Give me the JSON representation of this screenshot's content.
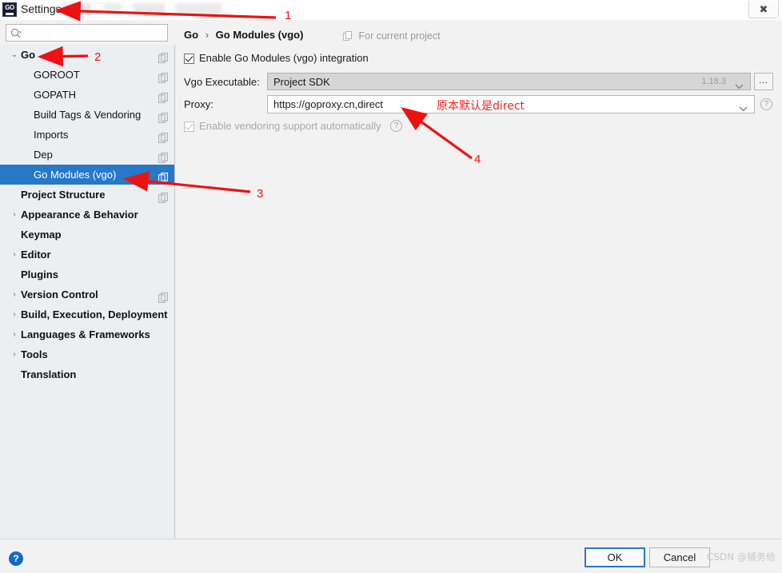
{
  "window": {
    "title": "Settings",
    "app_icon": "goland-logo-icon",
    "close_label": "✖",
    "blurred_subtitle": ""
  },
  "search": {
    "value": "",
    "placeholder": "",
    "icon": "search-icon"
  },
  "sidebar": {
    "items": [
      {
        "label": "Go",
        "level": 0,
        "bold": true,
        "expanded": true,
        "arrow": "⌄",
        "scope_icon": "project-scope-icon",
        "selected": false
      },
      {
        "label": "GOROOT",
        "level": 1,
        "bold": false,
        "arrow": "",
        "scope_icon": "project-scope-icon",
        "selected": false
      },
      {
        "label": "GOPATH",
        "level": 1,
        "bold": false,
        "arrow": "",
        "scope_icon": "project-scope-icon",
        "selected": false
      },
      {
        "label": "Build Tags & Vendoring",
        "level": 1,
        "bold": false,
        "arrow": "",
        "scope_icon": "project-scope-icon",
        "selected": false
      },
      {
        "label": "Imports",
        "level": 1,
        "bold": false,
        "arrow": "",
        "scope_icon": "project-scope-icon",
        "selected": false
      },
      {
        "label": "Dep",
        "level": 1,
        "bold": false,
        "arrow": "",
        "scope_icon": "project-scope-icon",
        "selected": false
      },
      {
        "label": "Go Modules (vgo)",
        "level": 1,
        "bold": false,
        "arrow": "",
        "scope_icon": "project-scope-icon",
        "selected": true
      },
      {
        "label": "Project Structure",
        "level": 0,
        "bold": true,
        "arrow": "",
        "scope_icon": "project-scope-icon",
        "selected": false
      },
      {
        "label": "Appearance & Behavior",
        "level": 0,
        "bold": true,
        "arrow": "›",
        "scope_icon": "",
        "selected": false
      },
      {
        "label": "Keymap",
        "level": 0,
        "bold": true,
        "arrow": "",
        "scope_icon": "",
        "selected": false
      },
      {
        "label": "Editor",
        "level": 0,
        "bold": true,
        "arrow": "›",
        "scope_icon": "",
        "selected": false
      },
      {
        "label": "Plugins",
        "level": 0,
        "bold": true,
        "arrow": "",
        "scope_icon": "",
        "selected": false
      },
      {
        "label": "Version Control",
        "level": 0,
        "bold": true,
        "arrow": "›",
        "scope_icon": "project-scope-icon",
        "selected": false
      },
      {
        "label": "Build, Execution, Deployment",
        "level": 0,
        "bold": true,
        "arrow": "›",
        "scope_icon": "",
        "selected": false
      },
      {
        "label": "Languages & Frameworks",
        "level": 0,
        "bold": true,
        "arrow": "›",
        "scope_icon": "",
        "selected": false
      },
      {
        "label": "Tools",
        "level": 0,
        "bold": true,
        "arrow": "›",
        "scope_icon": "",
        "selected": false
      },
      {
        "label": "Translation",
        "level": 0,
        "bold": true,
        "arrow": "",
        "scope_icon": "",
        "selected": false
      }
    ],
    "selected_color": "#2878c8"
  },
  "main": {
    "breadcrumb": {
      "root": "Go",
      "separator": "›",
      "leaf": "Go Modules (vgo)"
    },
    "for_current_project": "For current project",
    "enable_modules": {
      "label": "Enable Go Modules (vgo) integration",
      "checked": true,
      "enabled": true
    },
    "vgo_executable": {
      "label": "Vgo Executable:",
      "value": "Project SDK",
      "version": "1.18.3",
      "browse_label": "…"
    },
    "proxy": {
      "label": "Proxy:",
      "value": "https://goproxy.cn,direct",
      "help": "?"
    },
    "vendoring": {
      "label": "Enable vendoring support automatically",
      "checked": true,
      "enabled": false,
      "help": "?"
    }
  },
  "footer": {
    "help_label": "?",
    "ok_label": "OK",
    "cancel_label": "Cancel",
    "watermark": "CSDN @铺务给"
  },
  "annotations": {
    "accent_color": "#ee1111",
    "markers": [
      {
        "id": "1",
        "text": "1"
      },
      {
        "id": "2",
        "text": "2"
      },
      {
        "id": "3",
        "text": "3"
      },
      {
        "id": "4",
        "text": "4"
      }
    ],
    "note_cn": "原本默认是direct"
  }
}
